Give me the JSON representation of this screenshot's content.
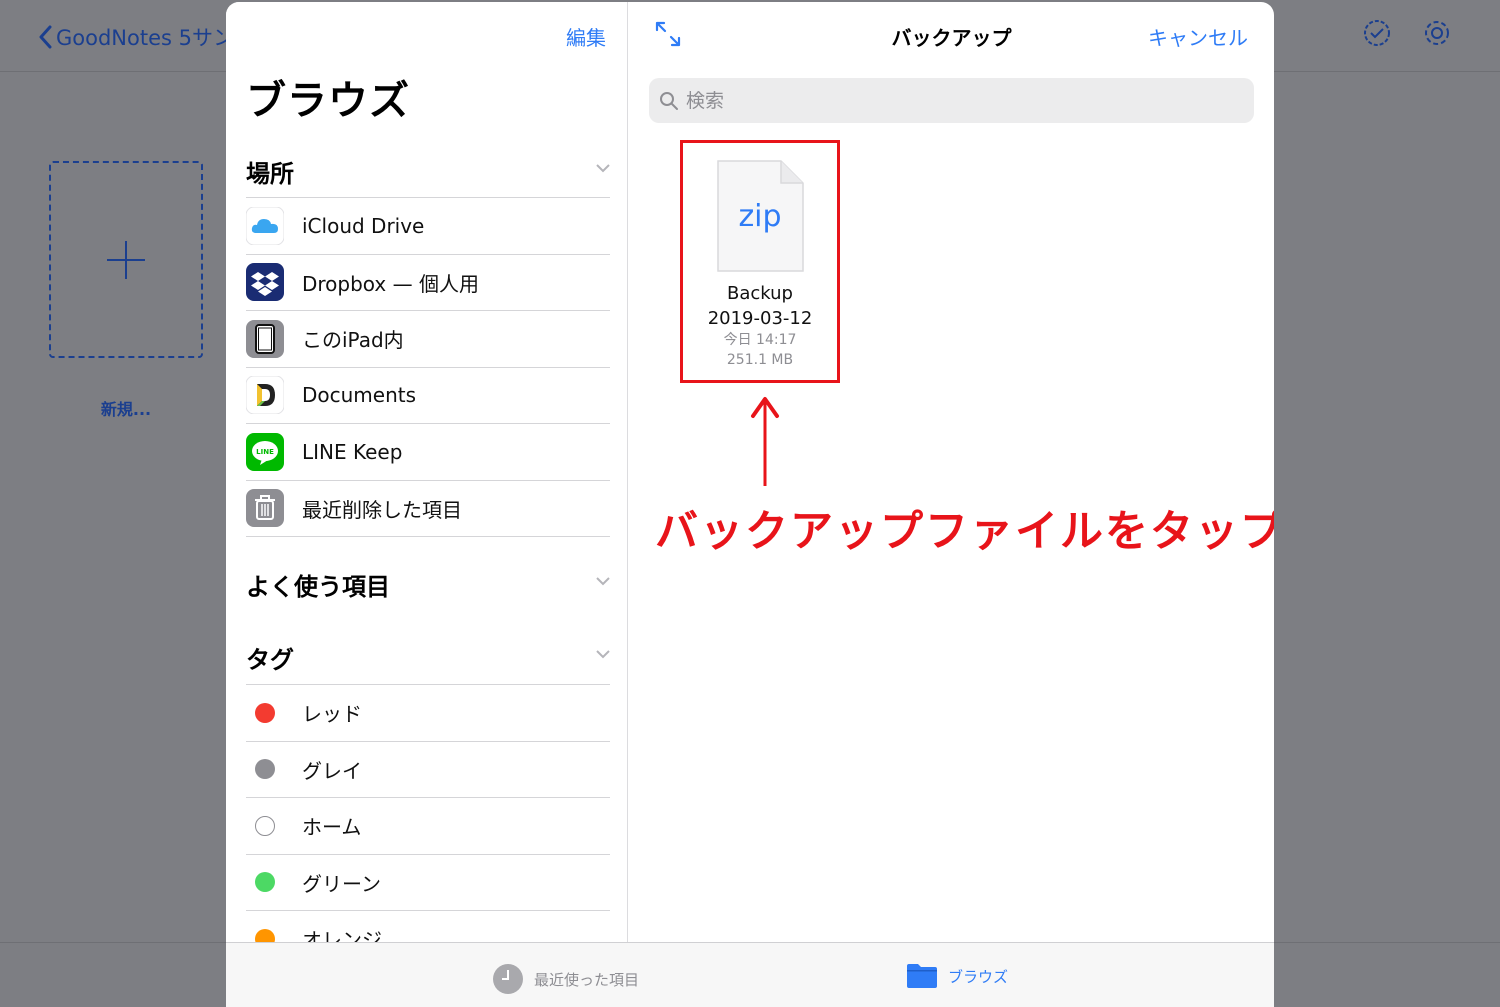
{
  "background": {
    "back_label": "GoodNotes 5サン",
    "new_label": "新規..."
  },
  "sidebar": {
    "edit_label": "編集",
    "title": "ブラウズ",
    "locations_header": "場所",
    "locations": [
      {
        "label": "iCloud Drive",
        "icon": "icloud-icon"
      },
      {
        "label": "Dropbox — 個人用",
        "icon": "dropbox-icon"
      },
      {
        "label": "このiPad内",
        "icon": "ipad-icon"
      },
      {
        "label": "Documents",
        "icon": "documents-icon"
      },
      {
        "label": "LINE Keep",
        "icon": "line-icon"
      },
      {
        "label": "最近削除した項目",
        "icon": "trash-icon"
      }
    ],
    "favorites_header": "よく使う項目",
    "tags_header": "タグ",
    "tags": [
      {
        "label": "レッド",
        "color": "#f33b30"
      },
      {
        "label": "グレイ",
        "color": "#8e8e93"
      },
      {
        "label": "ホーム",
        "color": "#ffffff"
      },
      {
        "label": "グリーン",
        "color": "#4cd964"
      },
      {
        "label": "オレンジ",
        "color": "#ff9500"
      }
    ]
  },
  "main": {
    "title": "バックアップ",
    "cancel_label": "キャンセル",
    "search_placeholder": "検索",
    "file": {
      "extension": "zip",
      "name_line1": "Backup",
      "name_line2": "2019-03-12",
      "date": "今日 14:17",
      "size": "251.1 MB"
    },
    "annotation": "バックアップファイルをタップ"
  },
  "tabbar": {
    "recent_label": "最近使った項目",
    "browse_label": "ブラウズ"
  },
  "colors": {
    "accent": "#2f7cf6",
    "annotation": "#e8141a"
  }
}
